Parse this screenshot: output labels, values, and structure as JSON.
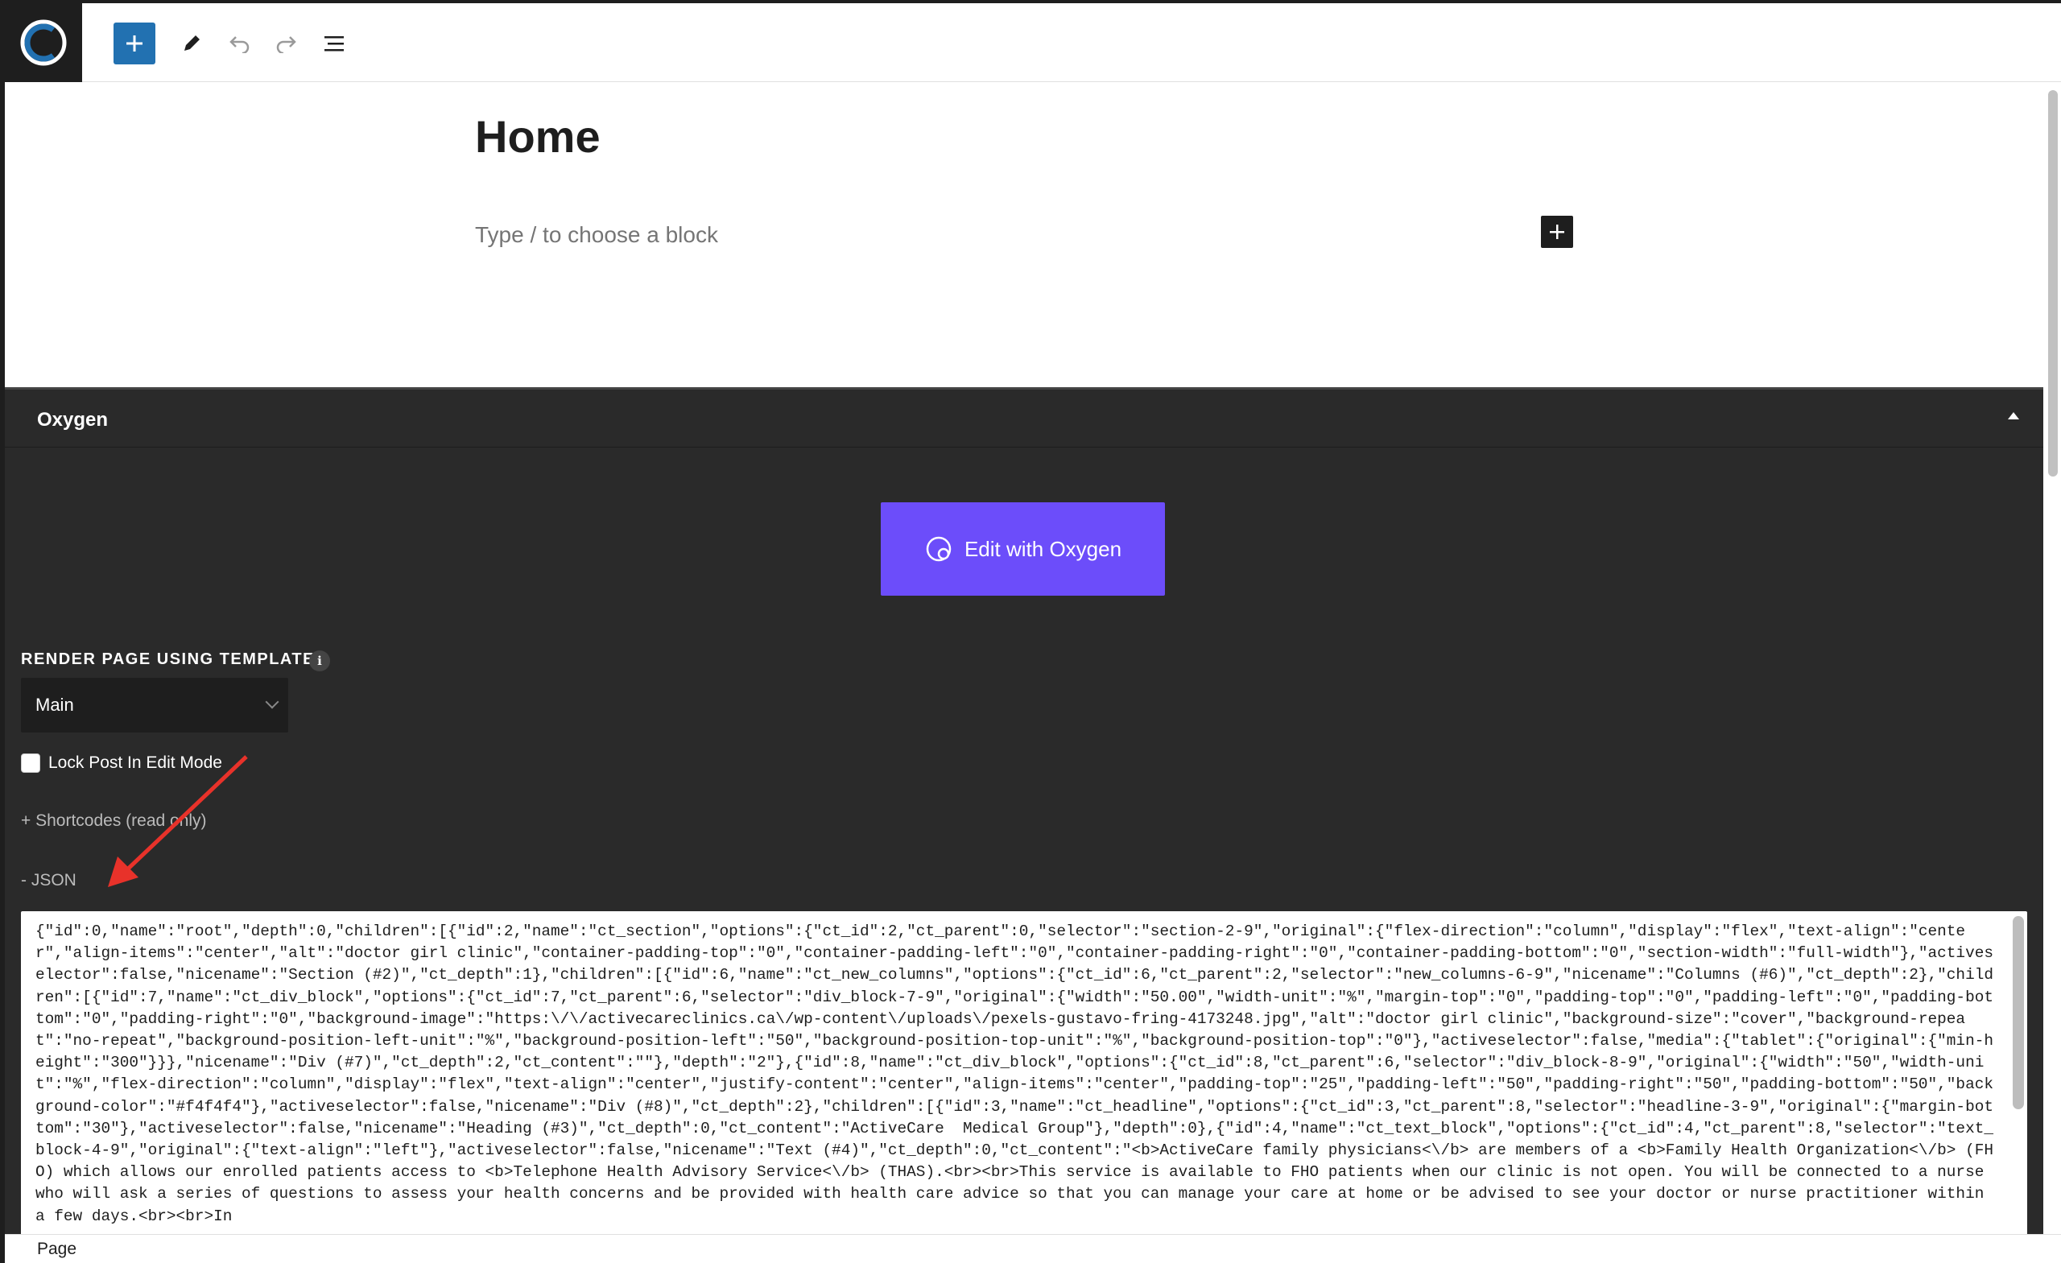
{
  "toolbar": {
    "logo_icon": "wordpress-logo-icon",
    "add_icon": "plus-icon",
    "edit_icon": "pencil-icon",
    "undo_icon": "undo-icon",
    "redo_icon": "redo-icon",
    "list_icon": "list-view-icon"
  },
  "editor": {
    "title": "Home",
    "placeholder": "Type / to choose a block"
  },
  "oxygen": {
    "title": "Oxygen",
    "edit_button": "Edit with Oxygen",
    "template_label": "RENDER PAGE USING TEMPLATE",
    "info": "i",
    "template_value": "Main",
    "lock_label": "Lock Post In Edit Mode",
    "shortcodes_label": "+ Shortcodes (read only)",
    "json_label": "- JSON",
    "json_content": "{\"id\":0,\"name\":\"root\",\"depth\":0,\"children\":[{\"id\":2,\"name\":\"ct_section\",\"options\":{\"ct_id\":2,\"ct_parent\":0,\"selector\":\"section-2-9\",\"original\":{\"flex-direction\":\"column\",\"display\":\"flex\",\"text-align\":\"center\",\"align-items\":\"center\",\"alt\":\"doctor girl clinic\",\"container-padding-top\":\"0\",\"container-padding-left\":\"0\",\"container-padding-right\":\"0\",\"container-padding-bottom\":\"0\",\"section-width\":\"full-width\"},\"activeselector\":false,\"nicename\":\"Section (#2)\",\"ct_depth\":1},\"children\":[{\"id\":6,\"name\":\"ct_new_columns\",\"options\":{\"ct_id\":6,\"ct_parent\":2,\"selector\":\"new_columns-6-9\",\"nicename\":\"Columns (#6)\",\"ct_depth\":2},\"children\":[{\"id\":7,\"name\":\"ct_div_block\",\"options\":{\"ct_id\":7,\"ct_parent\":6,\"selector\":\"div_block-7-9\",\"original\":{\"width\":\"50.00\",\"width-unit\":\"%\",\"margin-top\":\"0\",\"padding-top\":\"0\",\"padding-left\":\"0\",\"padding-bottom\":\"0\",\"padding-right\":\"0\",\"background-image\":\"https:\\/\\/activecareclinics.ca\\/wp-content\\/uploads\\/pexels-gustavo-fring-4173248.jpg\",\"alt\":\"doctor girl clinic\",\"background-size\":\"cover\",\"background-repeat\":\"no-repeat\",\"background-position-left-unit\":\"%\",\"background-position-left\":\"50\",\"background-position-top-unit\":\"%\",\"background-position-top\":\"0\"},\"activeselector\":false,\"media\":{\"tablet\":{\"original\":{\"min-height\":\"300\"}}},\"nicename\":\"Div (#7)\",\"ct_depth\":2,\"ct_content\":\"\"},\"depth\":\"2\"},{\"id\":8,\"name\":\"ct_div_block\",\"options\":{\"ct_id\":8,\"ct_parent\":6,\"selector\":\"div_block-8-9\",\"original\":{\"width\":\"50\",\"width-unit\":\"%\",\"flex-direction\":\"column\",\"display\":\"flex\",\"text-align\":\"center\",\"justify-content\":\"center\",\"align-items\":\"center\",\"padding-top\":\"25\",\"padding-left\":\"50\",\"padding-right\":\"50\",\"padding-bottom\":\"50\",\"background-color\":\"#f4f4f4\"},\"activeselector\":false,\"nicename\":\"Div (#8)\",\"ct_depth\":2},\"children\":[{\"id\":3,\"name\":\"ct_headline\",\"options\":{\"ct_id\":3,\"ct_parent\":8,\"selector\":\"headline-3-9\",\"original\":{\"margin-bottom\":\"30\"},\"activeselector\":false,\"nicename\":\"Heading (#3)\",\"ct_depth\":0,\"ct_content\":\"ActiveCare  Medical Group\"},\"depth\":0},{\"id\":4,\"name\":\"ct_text_block\",\"options\":{\"ct_id\":4,\"ct_parent\":8,\"selector\":\"text_block-4-9\",\"original\":{\"text-align\":\"left\"},\"activeselector\":false,\"nicename\":\"Text (#4)\",\"ct_depth\":0,\"ct_content\":\"<b>ActiveCare family physicians<\\/b> are members of a <b>Family Health Organization<\\/b> (FHO) which allows our enrolled patients access to <b>Telephone Health Advisory Service<\\/b> (THAS).<br><br>This service is available to FHO patients when our clinic is not open. You will be connected to a nurse who will ask a series of questions to assess your health concerns and be provided with health care advice so that you can manage your care at home or be advised to see your doctor or nurse practitioner within a few days.<br><br>In"
  },
  "footer": {
    "breadcrumb": "Page"
  },
  "colors": {
    "accent_blue": "#2271b1",
    "oxygen_purple": "#6c4dfa",
    "panel_dark": "#2a2a2a",
    "arrow_red": "#e8322a"
  }
}
